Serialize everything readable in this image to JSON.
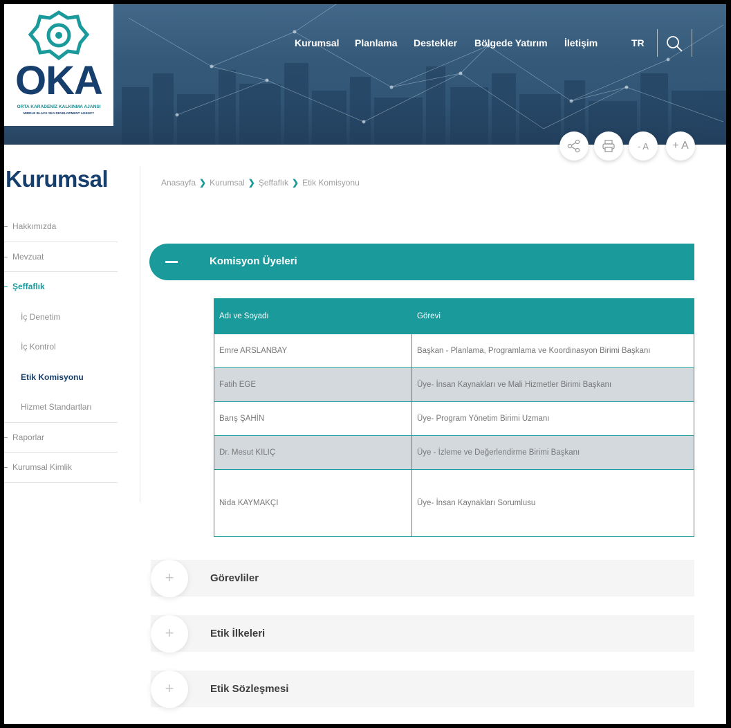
{
  "brand": {
    "logo_text": "OKA",
    "subtitle_tr": "ORTA KARADENİZ KALKINMA AJANSI",
    "subtitle_en": "MIDDLE BLACK SEA DEVELOPMENT AGENCY"
  },
  "nav": {
    "items": [
      "Kurumsal",
      "Planlama",
      "Destekler",
      "Bölgede Yatırım",
      "İletişim"
    ],
    "language": "TR"
  },
  "toolbar": {
    "decrease_font_label": "- A",
    "increase_font_label": "+ A"
  },
  "sidebar": {
    "title": "Kurumsal",
    "items": [
      {
        "label": "Hakkımızda"
      },
      {
        "label": "Mevzuat"
      },
      {
        "label": "Şeffaflık"
      },
      {
        "label": "İç Denetim"
      },
      {
        "label": "İç Kontrol"
      },
      {
        "label": "Etik Komisyonu"
      },
      {
        "label": "Hizmet Standartları"
      },
      {
        "label": "Raporlar"
      },
      {
        "label": "Kurumsal Kimlik"
      }
    ]
  },
  "breadcrumb": [
    "Anasayfa",
    "Kurumsal",
    "Şeffaflık",
    "Etik Komisyonu"
  ],
  "accordion": {
    "open": {
      "title": "Komisyon Üyeleri",
      "table": {
        "headers": [
          "Adı ve Soyadı",
          "Görevi"
        ],
        "rows": [
          [
            "Emre ARSLANBAY",
            " Başkan - Planlama, Programlama ve Koordinasyon Birimi Başkanı"
          ],
          [
            "Fatih EGE",
            "Üye- İnsan Kaynakları ve Mali Hizmetler Birimi Başkanı"
          ],
          [
            "Barış ŞAHİN",
            "Üye- Program Yönetim Birimi Uzmanı"
          ],
          [
            "Dr. Mesut KILIÇ",
            "Üye -  İzleme ve Değerlendirme Birimi Başkanı"
          ],
          [
            "Nida KAYMAKÇI",
            "Üye- İnsan Kaynakları Sorumlusu"
          ]
        ]
      }
    },
    "closed": [
      "Görevliler",
      "Etik İlkeleri",
      "Etik Sözleşmesi"
    ]
  },
  "colors": {
    "teal": "#1b9a9c",
    "navy": "#173f6e",
    "alt_row": "#d4d9de",
    "header_bg": "#2f5677"
  },
  "icons": [
    "share-icon",
    "print-icon",
    "search-icon",
    "minus-icon",
    "plus-icon",
    "chevron-right-icon"
  ]
}
